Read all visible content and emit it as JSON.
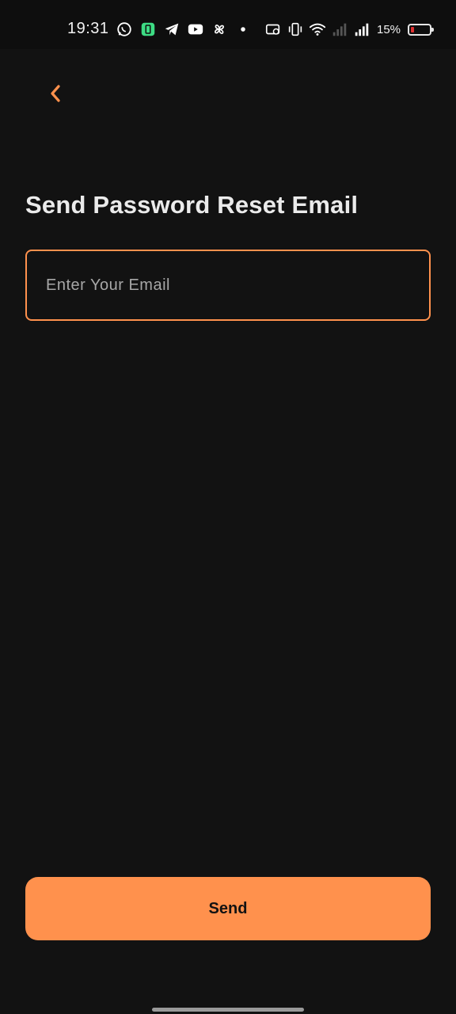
{
  "status_bar": {
    "time": "19:31",
    "battery_percent": "15%",
    "battery_level": 0.15,
    "left_icons": [
      "whatsapp-icon",
      "battery-saver-icon",
      "telegram-icon",
      "youtube-icon",
      "pinwheel-icon",
      "dot-icon"
    ],
    "right_icons": [
      "screen-record-icon",
      "vibrate-icon",
      "wifi-icon",
      "signal-icon-1",
      "signal-icon-2",
      "battery-icon"
    ]
  },
  "header": {
    "back_icon": "chevron-left-icon"
  },
  "main": {
    "title": "Send Password Reset Email",
    "email": {
      "value": "",
      "placeholder": "Enter Your Email"
    },
    "send_label": "Send"
  },
  "colors": {
    "accent": "#ff914d",
    "background": "#121212",
    "title": "#ebebeb"
  }
}
